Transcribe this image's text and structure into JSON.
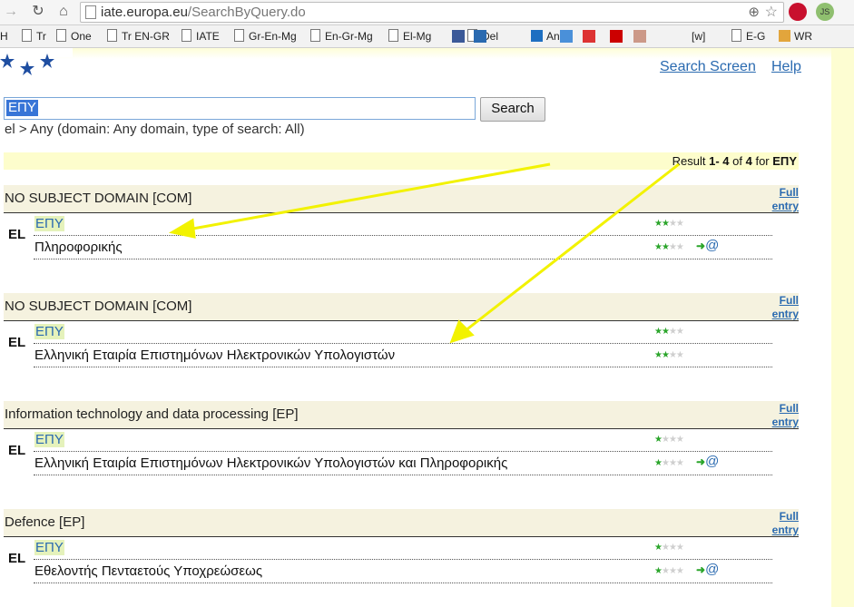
{
  "browser": {
    "url_host": "iate.europa.eu",
    "url_path": "/SearchByQuery.do",
    "extension_js_label": "JS"
  },
  "bookmarks": [
    {
      "label": "H",
      "icon": "none"
    },
    {
      "label": "Tr",
      "icon": "page-icon"
    },
    {
      "label": "One",
      "icon": "page-icon"
    },
    {
      "label": "Tr EN-GR",
      "icon": "page-icon"
    },
    {
      "label": "IATE",
      "icon": "page-icon"
    },
    {
      "label": "Gr-En-Mg",
      "icon": "page-icon"
    },
    {
      "label": "En-Gr-Mg",
      "icon": "page-icon"
    },
    {
      "label": "El-Mg",
      "icon": "page-icon"
    },
    {
      "label": "Del",
      "icon": "page-icon"
    },
    {
      "label": "Anl",
      "icon": "outlook-icon"
    },
    {
      "label": "[w]",
      "icon": "none"
    },
    {
      "label": "E-G",
      "icon": "page-icon"
    },
    {
      "label": "WR",
      "icon": "wr-icon"
    }
  ],
  "header": {
    "search_screen_label": "Search Screen",
    "help_label": "Help"
  },
  "search": {
    "query_value": "ΕΠΥ",
    "button_label": "Search",
    "description": "el > Any (domain: Any domain, type of search: All)"
  },
  "results": {
    "prefix": "Result",
    "range": "1- 4",
    "of_word": "of",
    "total": "4",
    "for_word": "for",
    "term": "ΕΠΥ"
  },
  "full_entry_line1": "Full",
  "full_entry_line2": "entry",
  "entries": [
    {
      "domain": "NO SUBJECT DOMAIN [COM]",
      "lang": "EL",
      "terms": [
        {
          "text": "ΕΠΥ",
          "rating": 2,
          "has_mail": false
        },
        {
          "text": "Πληροφορικής",
          "rating": 2,
          "has_mail": true
        }
      ]
    },
    {
      "domain": "NO SUBJECT DOMAIN [COM]",
      "lang": "EL",
      "terms": [
        {
          "text": "ΕΠΥ",
          "rating": 2,
          "has_mail": false
        },
        {
          "text": "Ελληνική Εταιρία Επιστημόνων Ηλεκτρονικών Υπολογιστών",
          "rating": 2,
          "has_mail": false
        }
      ]
    },
    {
      "domain": "Information technology and data processing [EP]",
      "lang": "EL",
      "terms": [
        {
          "text": "ΕΠΥ",
          "rating": 1,
          "has_mail": false
        },
        {
          "text": "Ελληνική Εταιρία Επιστημόνων Ηλεκτρονικών Υπολογιστών και Πληροφορικής",
          "rating": 1,
          "has_mail": true
        }
      ]
    },
    {
      "domain": "Defence [EP]",
      "lang": "EL",
      "terms": [
        {
          "text": "ΕΠΥ",
          "rating": 1,
          "has_mail": false
        },
        {
          "text": "Εθελοντής Πενταετούς Υποχρεώσεως",
          "rating": 1,
          "has_mail": true
        }
      ]
    }
  ],
  "colors": {
    "link": "#2a6ab0",
    "highlight": "#e5f2bb",
    "star_on": "#2aa52a",
    "arrow": "#f2f200"
  }
}
